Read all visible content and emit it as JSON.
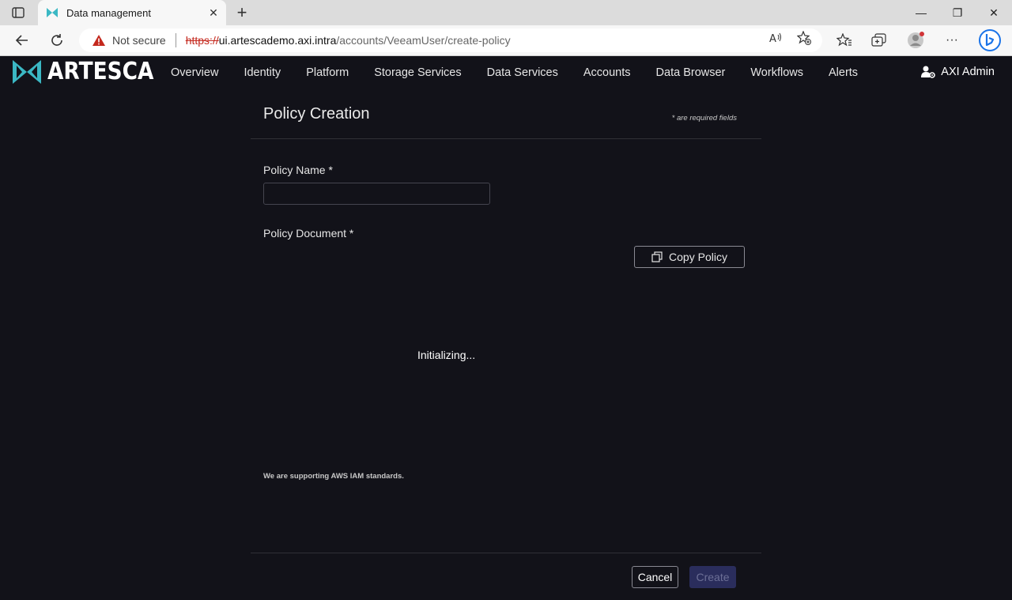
{
  "browser": {
    "tab_title": "Data management",
    "tab_close": "✕",
    "new_tab": "+",
    "security_label": "Not secure",
    "url_scheme": "https://",
    "url_host": "ui.artescademo.axi.intra",
    "url_path": "/accounts/VeeamUser/create-policy",
    "window_minimize": "—",
    "window_restore": "❐",
    "window_close": "✕",
    "more_label": "···"
  },
  "app": {
    "brand": "ARTESCA",
    "brand_color": "#3bb8c4",
    "nav": [
      "Overview",
      "Identity",
      "Platform",
      "Storage Services",
      "Data Services",
      "Accounts",
      "Data Browser",
      "Workflows",
      "Alerts"
    ],
    "user_name": "AXI Admin"
  },
  "form": {
    "title": "Policy Creation",
    "required_note": "* are required fields",
    "policy_name_label": "Policy Name *",
    "policy_name_value": "",
    "policy_document_label": "Policy Document *",
    "copy_button": "Copy Policy",
    "editor_status": "Initializing...",
    "support_note": "We are supporting AWS IAM standards.",
    "cancel_button": "Cancel",
    "create_button": "Create"
  },
  "icons": {
    "tab_favicon": "artesca-logo-icon",
    "warning": "warning-triangle-icon",
    "copy": "copy-icon",
    "user": "user-gear-icon"
  }
}
